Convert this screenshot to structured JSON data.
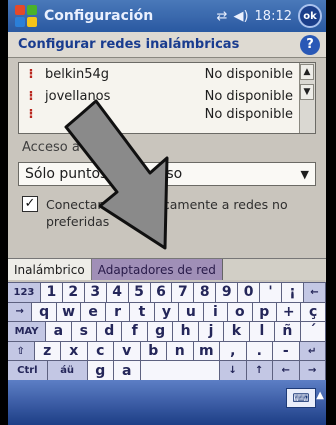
{
  "titlebar": {
    "app_title": "Configuración",
    "signal_icon": "signal-icon",
    "volume_icon": "volume-icon",
    "time": "18:12",
    "ok_label": "ok"
  },
  "header": {
    "title": "Configurar redes inalámbricas",
    "help_label": "?"
  },
  "networks": [
    {
      "ssid": "belkin54g",
      "status": "No disponible"
    },
    {
      "ssid": "jovellanos",
      "status": "No disponible"
    },
    {
      "ssid": "",
      "status": "No disponible"
    }
  ],
  "access": {
    "label": "Acceso a redes:",
    "selected": "Sólo puntos de acceso"
  },
  "checkbox": {
    "label": "Conectar automáticamente a redes no preferidas",
    "checked": true,
    "check_mark": "✓"
  },
  "tabs": [
    {
      "label": "Inalámbrico"
    },
    {
      "label": "Adaptadores de red"
    }
  ],
  "keyboard": {
    "rows": [
      [
        "123",
        "1",
        "2",
        "3",
        "4",
        "5",
        "6",
        "7",
        "8",
        "9",
        "0",
        "'",
        "¡",
        "←"
      ],
      [
        "→",
        "q",
        "w",
        "e",
        "r",
        "t",
        "y",
        "u",
        "i",
        "o",
        "p",
        "+",
        "ç"
      ],
      [
        "MAY",
        "a",
        "s",
        "d",
        "f",
        "g",
        "h",
        "j",
        "k",
        "l",
        "ñ",
        "´"
      ],
      [
        "⇧",
        "z",
        "x",
        "c",
        "v",
        "b",
        "n",
        "m",
        ",",
        ".",
        "-",
        "↵"
      ],
      [
        "Ctrl",
        "áü",
        "g",
        "a",
        " ",
        "↓",
        "↑",
        "←",
        "→"
      ]
    ]
  },
  "colors": {
    "titlebar": "#2c5aa0",
    "tab_inactive": "#9f8fb6",
    "keyboard_bg": "#cfd3e8"
  }
}
